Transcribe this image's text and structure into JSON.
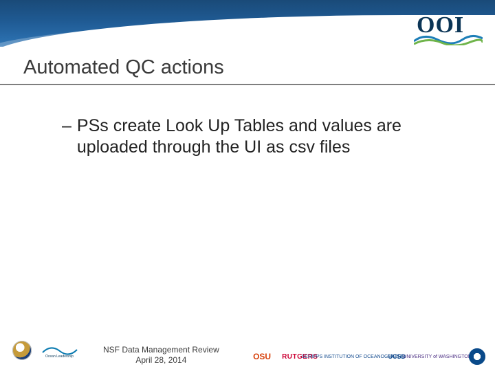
{
  "header": {
    "logo_text": "OOI"
  },
  "title": "Automated QC actions",
  "body": {
    "bullet1": "PSs create Look Up Tables and values are uploaded through the UI as csv files"
  },
  "footer": {
    "line1": "NSF Data Management Review",
    "line2": "April 28, 2014",
    "logos": {
      "osu": "OSU",
      "rutgers": "RUTGERS",
      "scripps": "SCRIPPS INSTITUTION OF OCEANOGRAPHY",
      "ucsd": "UCSD",
      "uw": "UNIVERSITY of WASHINGTON"
    }
  }
}
